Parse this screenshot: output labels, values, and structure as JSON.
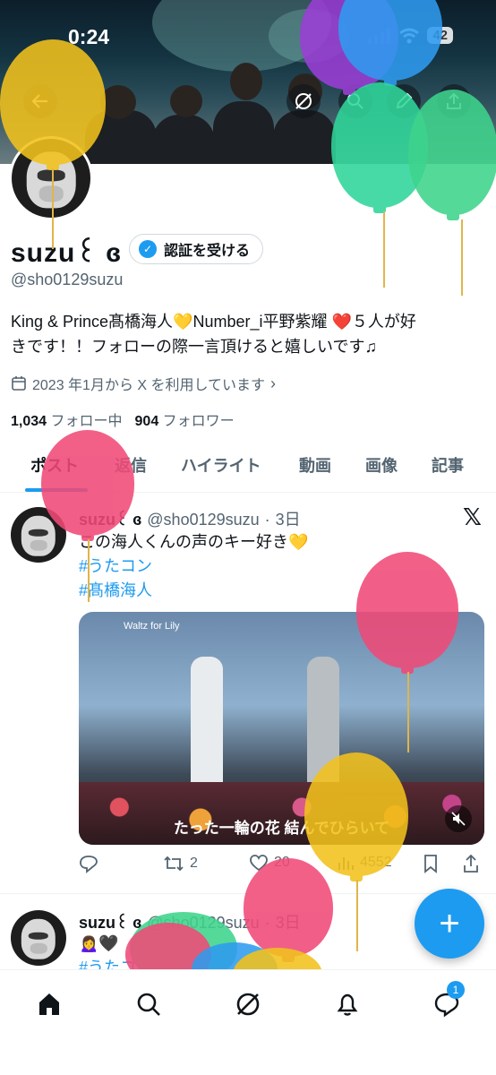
{
  "status_bar": {
    "time": "0:24",
    "battery": "42"
  },
  "profile": {
    "display_name": "suzu꒰ ɞ",
    "verify_label": "認証を受ける",
    "handle": "@sho0129suzu",
    "bio_line1": "King & Prince髙橋海人💛Number_i平野紫耀 ❤️５人が好",
    "bio_line2": "きです！！フォローの際一言頂けると嬉しいです♫",
    "joined": "2023 年1月から X を利用しています",
    "following_count": "1,034",
    "following_label": "フォロー中",
    "followers_count": "904",
    "followers_label": "フォロワー"
  },
  "tabs": [
    "ポスト",
    "返信",
    "ハイライト",
    "動画",
    "画像",
    "記事"
  ],
  "tweets": [
    {
      "name": "suzu꒰ ɞ",
      "handle": "@sho0129suzu",
      "time": "3日",
      "text": "この海人くんの声のキー好き💛",
      "hashtags": [
        "#うたコン",
        "#髙橋海人"
      ],
      "media_caption": "たった一輪の花 結んでひらいて",
      "media_label": "Waltz for Lily",
      "retweets": "2",
      "likes": "20",
      "views": "4552"
    },
    {
      "name": "suzu꒰ ɞ",
      "handle": "@sho0129suzu",
      "time": "3日",
      "text": "🙍‍♀️🖤",
      "hashtags": [
        "#うたコ"
      ]
    }
  ],
  "notifications_badge": "1",
  "colors": {
    "accent": "#1d9bf0",
    "text": "#0f1419",
    "muted": "#536471"
  }
}
